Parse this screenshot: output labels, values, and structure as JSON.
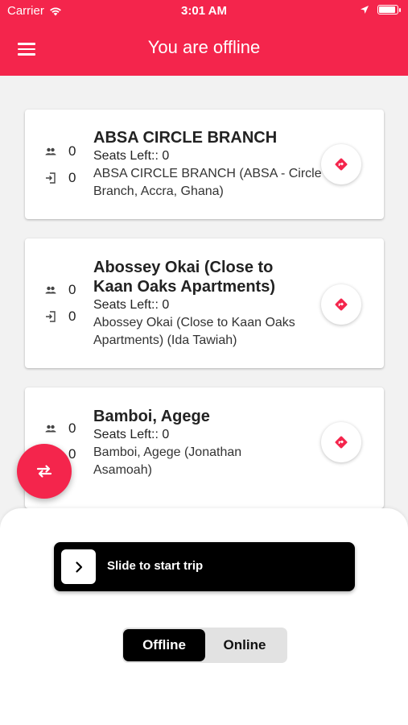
{
  "status_bar": {
    "carrier": "Carrier",
    "time": "3:01 AM"
  },
  "app_bar": {
    "title": "You are offline",
    "menu_icon": "hamburger-menu-icon"
  },
  "stops": [
    {
      "title": "ABSA CIRCLE BRANCH",
      "seats": "Seats Left:: 0",
      "address": "ABSA CIRCLE BRANCH (ABSA - Circle Branch, Accra, Ghana)",
      "passengers": "0",
      "boarded": "0"
    },
    {
      "title": "Abossey Okai (Close to Kaan Oaks Apartments)",
      "seats": "Seats Left:: 0",
      "address": "Abossey Okai (Close to Kaan Oaks Apartments) (Ida Tawiah)",
      "passengers": "0",
      "boarded": "0"
    },
    {
      "title": "Bamboi, Agege",
      "seats": "Seats Left:: 0",
      "address": "Bamboi, Agege (Jonathan Asamoah)",
      "passengers": "0",
      "boarded": "0"
    }
  ],
  "slider": {
    "label": "Slide to start trip"
  },
  "mode_toggle": {
    "offline_label": "Offline",
    "online_label": "Online",
    "selected": "Offline"
  },
  "colors": {
    "accent": "#f4254c",
    "slider_bg": "#000000"
  }
}
